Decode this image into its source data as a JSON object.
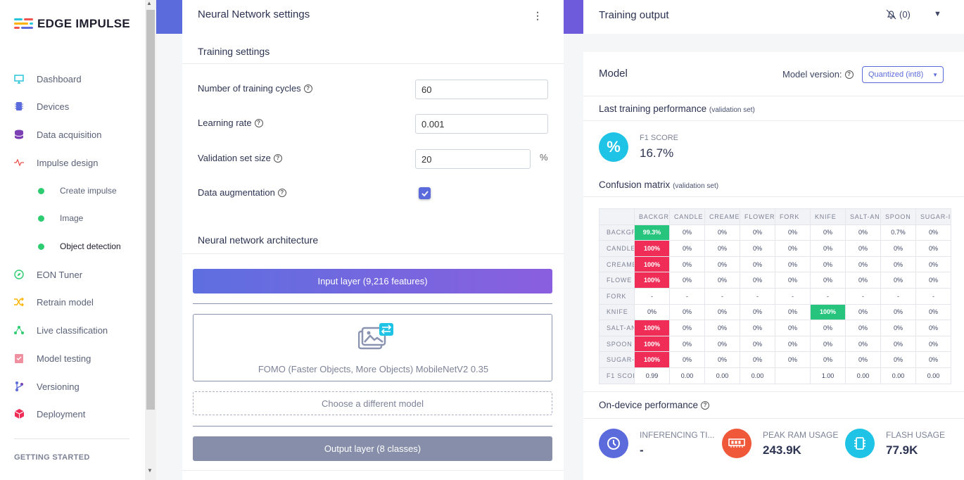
{
  "brand": {
    "name": "EDGE IMPULSE"
  },
  "sidebar": {
    "items": [
      {
        "label": "Dashboard",
        "icon": "monitor-icon"
      },
      {
        "label": "Devices",
        "icon": "chip-icon"
      },
      {
        "label": "Data acquisition",
        "icon": "database-icon"
      },
      {
        "label": "Impulse design",
        "icon": "pulse-icon"
      },
      {
        "label": "Create impulse",
        "icon": "dot"
      },
      {
        "label": "Image",
        "icon": "dot"
      },
      {
        "label": "Object detection",
        "icon": "dot"
      },
      {
        "label": "EON Tuner",
        "icon": "compass-icon"
      },
      {
        "label": "Retrain model",
        "icon": "shuffle-icon"
      },
      {
        "label": "Live classification",
        "icon": "share-icon"
      },
      {
        "label": "Model testing",
        "icon": "clipboard-icon"
      },
      {
        "label": "Versioning",
        "icon": "branch-icon"
      },
      {
        "label": "Deployment",
        "icon": "box-icon"
      }
    ],
    "getting_started": "GETTING STARTED"
  },
  "nn": {
    "title": "Neural Network settings",
    "training_settings": "Training settings",
    "fields": {
      "cycles_label": "Number of training cycles",
      "cycles_value": "60",
      "lr_label": "Learning rate",
      "lr_value": "0.001",
      "val_label": "Validation set size",
      "val_value": "20",
      "val_unit": "%",
      "aug_label": "Data augmentation",
      "aug_checked": true
    },
    "architecture_title": "Neural network architecture",
    "input_layer": "Input layer (9,216 features)",
    "model_name": "FOMO (Faster Objects, More Objects) MobileNetV2 0.35",
    "choose_model": "Choose a different model",
    "output_layer": "Output layer (8 classes)"
  },
  "training_output": {
    "title": "Training output",
    "notifications": "(0)"
  },
  "model": {
    "title": "Model",
    "version_label": "Model version:",
    "version_value": "Quantized (int8)",
    "last_perf_title": "Last training performance",
    "last_perf_note": "(validation set)",
    "f1_label": "F1 SCORE",
    "f1_value": "16.7%",
    "cm_title": "Confusion matrix",
    "cm_note": "(validation set)",
    "cm_columns": [
      "BACKGR",
      "CANDLE",
      "CREAME",
      "FLOWER",
      "FORK",
      "KNIFE",
      "SALT-AN",
      "SPOON",
      "SUGAR-I"
    ],
    "cm_rows": [
      {
        "label": "BACKGR",
        "cells": [
          "99.3%",
          "0%",
          "0%",
          "0%",
          "0%",
          "0%",
          "0%",
          "0.7%",
          "0%"
        ]
      },
      {
        "label": "CANDLE",
        "cells": [
          "100%",
          "0%",
          "0%",
          "0%",
          "0%",
          "0%",
          "0%",
          "0%",
          "0%"
        ]
      },
      {
        "label": "CREAME",
        "cells": [
          "100%",
          "0%",
          "0%",
          "0%",
          "0%",
          "0%",
          "0%",
          "0%",
          "0%"
        ]
      },
      {
        "label": "FLOWE",
        "cells": [
          "100%",
          "0%",
          "0%",
          "0%",
          "0%",
          "0%",
          "0%",
          "0%",
          "0%"
        ]
      },
      {
        "label": "FORK",
        "cells": [
          "-",
          "-",
          "-",
          "-",
          "-",
          "-",
          "-",
          "-",
          "-"
        ]
      },
      {
        "label": "KNIFE",
        "cells": [
          "0%",
          "0%",
          "0%",
          "0%",
          "0%",
          "100%",
          "0%",
          "0%",
          "0%"
        ]
      },
      {
        "label": "SALT-AN",
        "cells": [
          "100%",
          "0%",
          "0%",
          "0%",
          "0%",
          "0%",
          "0%",
          "0%",
          "0%"
        ]
      },
      {
        "label": "SPOON",
        "cells": [
          "100%",
          "0%",
          "0%",
          "0%",
          "0%",
          "0%",
          "0%",
          "0%",
          "0%"
        ]
      },
      {
        "label": "SUGAR-",
        "cells": [
          "100%",
          "0%",
          "0%",
          "0%",
          "0%",
          "0%",
          "0%",
          "0%",
          "0%"
        ]
      }
    ],
    "cm_f1_row": {
      "label": "F1 SCOI",
      "cells": [
        "0.99",
        "0.00",
        "0.00",
        "0.00",
        "",
        "1.00",
        "0.00",
        "0.00",
        "0.00"
      ]
    },
    "cm_highlight": {
      "green": [
        [
          0,
          0
        ],
        [
          5,
          5
        ]
      ],
      "red": [
        [
          1,
          0
        ],
        [
          2,
          0
        ],
        [
          3,
          0
        ],
        [
          6,
          0
        ],
        [
          7,
          0
        ],
        [
          8,
          0
        ]
      ]
    },
    "on_device_title": "On-device performance",
    "perf": [
      {
        "label": "INFERENCING TI...",
        "value": "-",
        "color": "#5c6bdb",
        "icon": "clock-icon"
      },
      {
        "label": "PEAK RAM USAGE",
        "value": "243.9K",
        "color": "#f0583a",
        "icon": "ram-icon"
      },
      {
        "label": "FLASH USAGE",
        "value": "77.9K",
        "color": "#1ec3e6",
        "icon": "chip-icon"
      }
    ]
  },
  "colors": {
    "accent": "#5c6bdb",
    "green": "#27c47d",
    "red": "#ef2d56",
    "cyan": "#1ec3e6"
  }
}
